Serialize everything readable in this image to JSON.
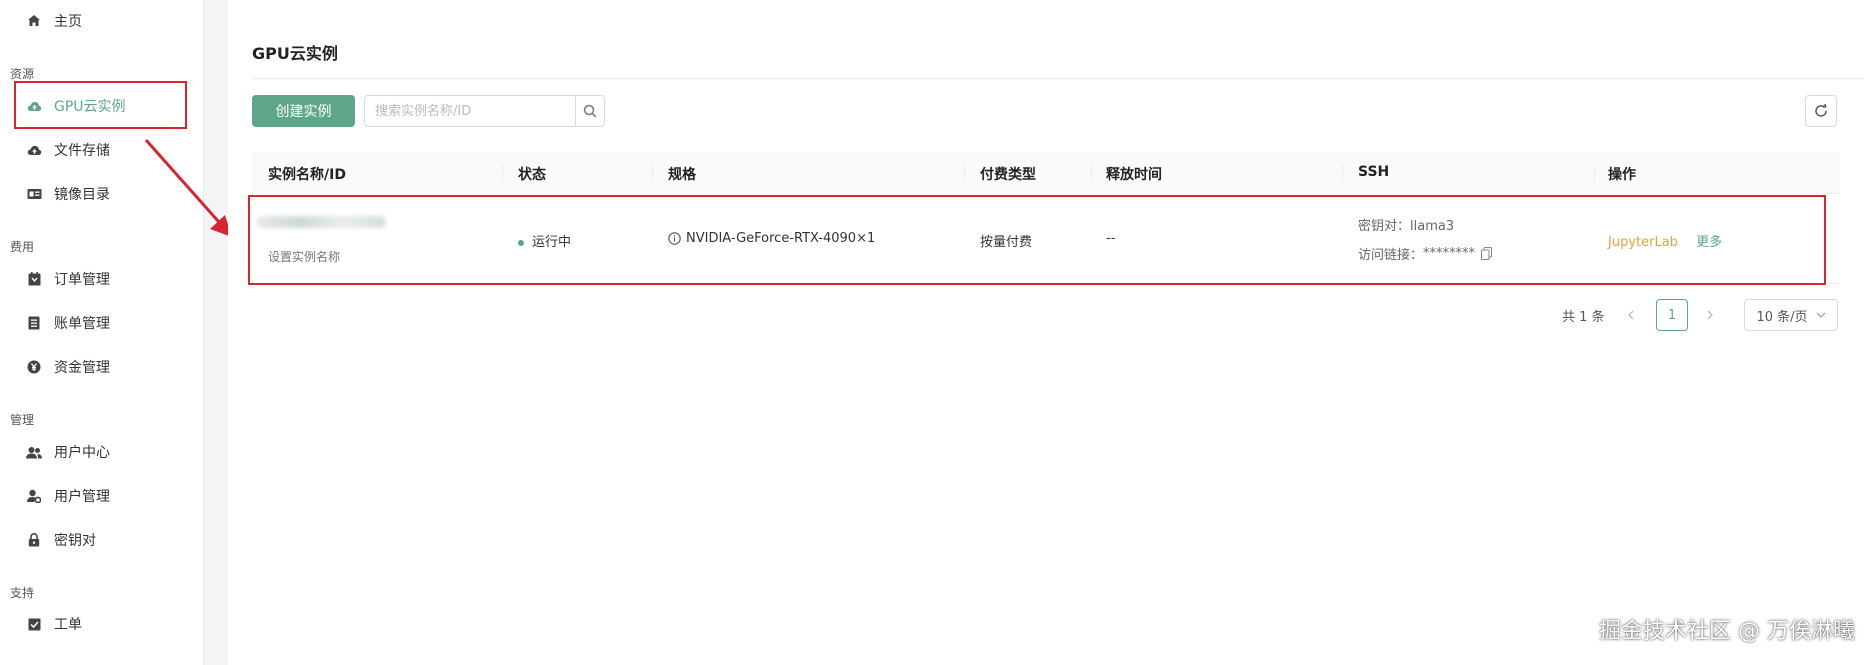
{
  "sidebar": {
    "home": "主页",
    "section_resources": "资源",
    "gpu_instances": "GPU云实例",
    "file_storage": "文件存储",
    "image_catalog": "镜像目录",
    "section_billing": "费用",
    "order_mgmt": "订单管理",
    "bill_mgmt": "账单管理",
    "fund_mgmt": "资金管理",
    "section_manage": "管理",
    "user_center": "用户中心",
    "user_mgmt": "用户管理",
    "key_pair": "密钥对",
    "section_support": "支持",
    "ticket": "工单"
  },
  "main": {
    "title": "GPU云实例",
    "create_button": "创建实例",
    "search_placeholder": "搜索实例名称/ID"
  },
  "table": {
    "columns": {
      "name": "实例名称/ID",
      "status": "状态",
      "spec": "规格",
      "payment": "付费类型",
      "release": "释放时间",
      "ssh": "SSH",
      "actions": "操作"
    },
    "row": {
      "set_name": "设置实例名称",
      "status": "运行中",
      "spec": "NVIDIA-GeForce-RTX-4090×1",
      "payment": "按量付费",
      "release": "--",
      "ssh_key_label": "密钥对：",
      "ssh_key_value": "llama3",
      "ssh_link_label": "访问链接：",
      "ssh_link_value": "********",
      "action_jupyter": "JupyterLab",
      "action_more": "更多"
    }
  },
  "pagination": {
    "total": "共 1 条",
    "current_page": "1",
    "page_size": "10 条/页"
  },
  "watermark": "掘金技术社区 @ 万俟淋曦",
  "colors": {
    "accent": "#5ea68a",
    "link_orange": "#e0a43a",
    "highlight_red": "#d6262e"
  }
}
